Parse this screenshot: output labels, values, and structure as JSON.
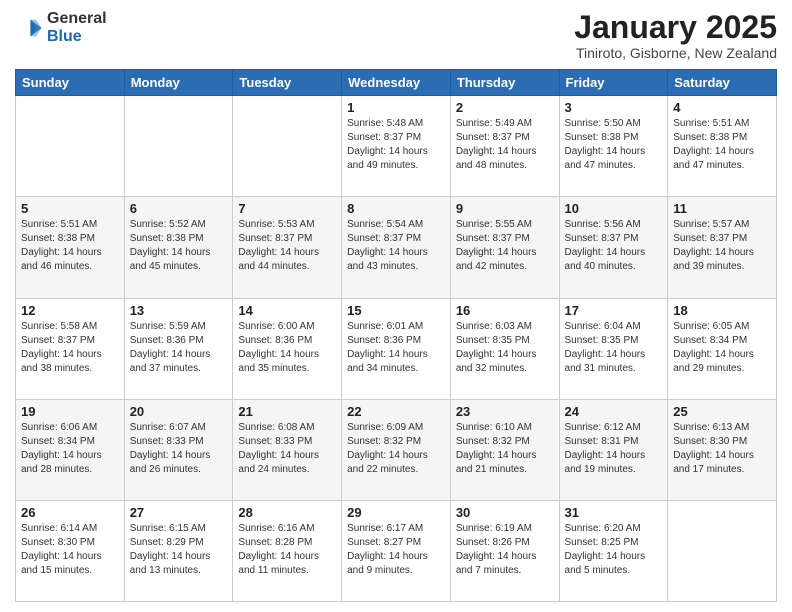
{
  "logo": {
    "general": "General",
    "blue": "Blue"
  },
  "header": {
    "month": "January 2025",
    "location": "Tiniroto, Gisborne, New Zealand"
  },
  "weekdays": [
    "Sunday",
    "Monday",
    "Tuesday",
    "Wednesday",
    "Thursday",
    "Friday",
    "Saturday"
  ],
  "weeks": [
    [
      null,
      null,
      null,
      {
        "day": 1,
        "sunrise": "5:48 AM",
        "sunset": "8:37 PM",
        "daylight": "14 hours and 49 minutes."
      },
      {
        "day": 2,
        "sunrise": "5:49 AM",
        "sunset": "8:37 PM",
        "daylight": "14 hours and 48 minutes."
      },
      {
        "day": 3,
        "sunrise": "5:50 AM",
        "sunset": "8:38 PM",
        "daylight": "14 hours and 47 minutes."
      },
      {
        "day": 4,
        "sunrise": "5:51 AM",
        "sunset": "8:38 PM",
        "daylight": "14 hours and 47 minutes."
      }
    ],
    [
      {
        "day": 5,
        "sunrise": "5:51 AM",
        "sunset": "8:38 PM",
        "daylight": "14 hours and 46 minutes."
      },
      {
        "day": 6,
        "sunrise": "5:52 AM",
        "sunset": "8:38 PM",
        "daylight": "14 hours and 45 minutes."
      },
      {
        "day": 7,
        "sunrise": "5:53 AM",
        "sunset": "8:37 PM",
        "daylight": "14 hours and 44 minutes."
      },
      {
        "day": 8,
        "sunrise": "5:54 AM",
        "sunset": "8:37 PM",
        "daylight": "14 hours and 43 minutes."
      },
      {
        "day": 9,
        "sunrise": "5:55 AM",
        "sunset": "8:37 PM",
        "daylight": "14 hours and 42 minutes."
      },
      {
        "day": 10,
        "sunrise": "5:56 AM",
        "sunset": "8:37 PM",
        "daylight": "14 hours and 40 minutes."
      },
      {
        "day": 11,
        "sunrise": "5:57 AM",
        "sunset": "8:37 PM",
        "daylight": "14 hours and 39 minutes."
      }
    ],
    [
      {
        "day": 12,
        "sunrise": "5:58 AM",
        "sunset": "8:37 PM",
        "daylight": "14 hours and 38 minutes."
      },
      {
        "day": 13,
        "sunrise": "5:59 AM",
        "sunset": "8:36 PM",
        "daylight": "14 hours and 37 minutes."
      },
      {
        "day": 14,
        "sunrise": "6:00 AM",
        "sunset": "8:36 PM",
        "daylight": "14 hours and 35 minutes."
      },
      {
        "day": 15,
        "sunrise": "6:01 AM",
        "sunset": "8:36 PM",
        "daylight": "14 hours and 34 minutes."
      },
      {
        "day": 16,
        "sunrise": "6:03 AM",
        "sunset": "8:35 PM",
        "daylight": "14 hours and 32 minutes."
      },
      {
        "day": 17,
        "sunrise": "6:04 AM",
        "sunset": "8:35 PM",
        "daylight": "14 hours and 31 minutes."
      },
      {
        "day": 18,
        "sunrise": "6:05 AM",
        "sunset": "8:34 PM",
        "daylight": "14 hours and 29 minutes."
      }
    ],
    [
      {
        "day": 19,
        "sunrise": "6:06 AM",
        "sunset": "8:34 PM",
        "daylight": "14 hours and 28 minutes."
      },
      {
        "day": 20,
        "sunrise": "6:07 AM",
        "sunset": "8:33 PM",
        "daylight": "14 hours and 26 minutes."
      },
      {
        "day": 21,
        "sunrise": "6:08 AM",
        "sunset": "8:33 PM",
        "daylight": "14 hours and 24 minutes."
      },
      {
        "day": 22,
        "sunrise": "6:09 AM",
        "sunset": "8:32 PM",
        "daylight": "14 hours and 22 minutes."
      },
      {
        "day": 23,
        "sunrise": "6:10 AM",
        "sunset": "8:32 PM",
        "daylight": "14 hours and 21 minutes."
      },
      {
        "day": 24,
        "sunrise": "6:12 AM",
        "sunset": "8:31 PM",
        "daylight": "14 hours and 19 minutes."
      },
      {
        "day": 25,
        "sunrise": "6:13 AM",
        "sunset": "8:30 PM",
        "daylight": "14 hours and 17 minutes."
      }
    ],
    [
      {
        "day": 26,
        "sunrise": "6:14 AM",
        "sunset": "8:30 PM",
        "daylight": "14 hours and 15 minutes."
      },
      {
        "day": 27,
        "sunrise": "6:15 AM",
        "sunset": "8:29 PM",
        "daylight": "14 hours and 13 minutes."
      },
      {
        "day": 28,
        "sunrise": "6:16 AM",
        "sunset": "8:28 PM",
        "daylight": "14 hours and 11 minutes."
      },
      {
        "day": 29,
        "sunrise": "6:17 AM",
        "sunset": "8:27 PM",
        "daylight": "14 hours and 9 minutes."
      },
      {
        "day": 30,
        "sunrise": "6:19 AM",
        "sunset": "8:26 PM",
        "daylight": "14 hours and 7 minutes."
      },
      {
        "day": 31,
        "sunrise": "6:20 AM",
        "sunset": "8:25 PM",
        "daylight": "14 hours and 5 minutes."
      },
      null
    ]
  ]
}
